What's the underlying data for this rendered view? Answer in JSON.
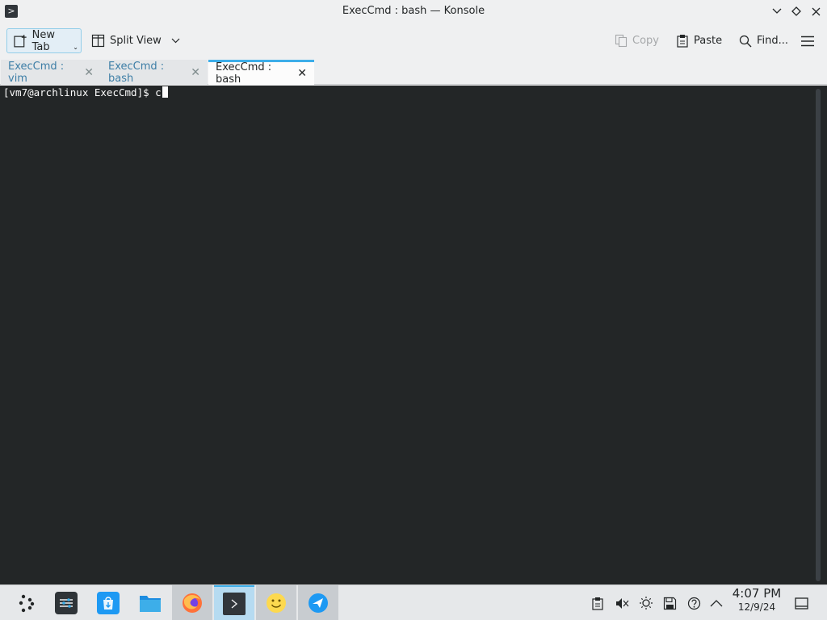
{
  "window": {
    "title": "ExecCmd : bash — Konsole",
    "app_icon": ">",
    "controls": [
      "chevron-down-icon",
      "diamond-icon",
      "close-icon"
    ]
  },
  "toolbar": {
    "new_tab_label": "New Tab",
    "split_view_label": "Split View",
    "copy_label": "Copy",
    "paste_label": "Paste",
    "find_label": "Find..."
  },
  "tabs": [
    {
      "label": "ExecCmd : vim",
      "active": false
    },
    {
      "label": "ExecCmd : bash",
      "active": false
    },
    {
      "label": "ExecCmd : bash",
      "active": true
    }
  ],
  "terminal": {
    "prompt": "[vm7@archlinux ExecCmd]$ ",
    "input": "c"
  },
  "taskbar": {
    "apps": [
      {
        "name": "application-launcher",
        "icon": "⁘"
      },
      {
        "name": "system-settings",
        "icon": "≡"
      },
      {
        "name": "discover",
        "icon": "⬇"
      },
      {
        "name": "file-manager",
        "icon": "▬"
      },
      {
        "name": "firefox",
        "icon": "●"
      },
      {
        "name": "konsole",
        "icon": ">"
      },
      {
        "name": "emoji",
        "icon": "☺"
      },
      {
        "name": "kde-connect",
        "icon": "✈"
      }
    ],
    "clock_time": "4:07 PM",
    "clock_date": "12/9/24"
  },
  "colors": {
    "accent": "#3daee9",
    "terminal_bg": "#232627",
    "terminal_fg": "#fcfcfc"
  }
}
